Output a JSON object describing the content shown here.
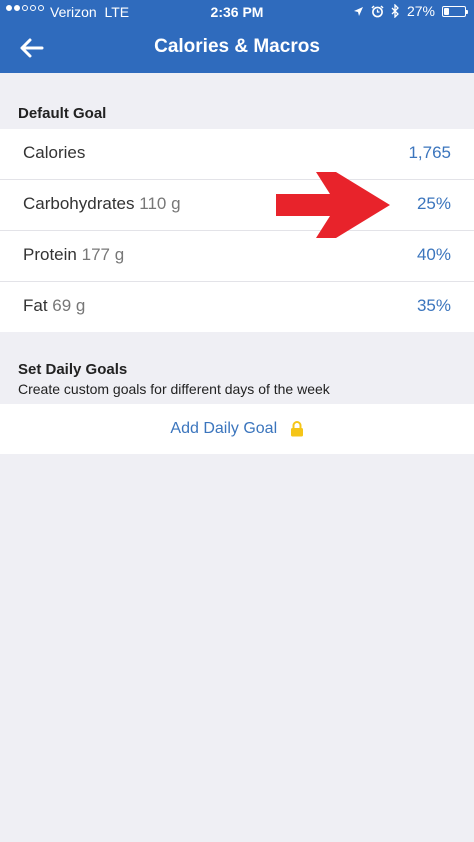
{
  "status_bar": {
    "carrier": "Verizon",
    "network": "LTE",
    "time": "2:36 PM",
    "battery": "27%",
    "battery_level": 0.27,
    "icons": [
      "location-icon",
      "alarm-icon",
      "bluetooth-icon"
    ]
  },
  "nav": {
    "title": "Calories & Macros",
    "back_icon": "back-arrow-icon"
  },
  "default_goal": {
    "header": "Default Goal",
    "rows": [
      {
        "label": "Calories",
        "detail": "",
        "value": "1,765"
      },
      {
        "label": "Carbohydrates",
        "detail": "110 g",
        "value": "25%"
      },
      {
        "label": "Protein",
        "detail": "177 g",
        "value": "40%"
      },
      {
        "label": "Fat",
        "detail": "69 g",
        "value": "35%"
      }
    ]
  },
  "daily_goals": {
    "header": "Set Daily Goals",
    "subtitle": "Create custom goals for different days of the week",
    "add_label": "Add Daily Goal",
    "lock_icon": "lock-icon"
  },
  "colors": {
    "nav_bg": "#2f6bbd",
    "accent": "#3b75bd",
    "annotation_arrow": "#e8232b",
    "lock": "#f5c518"
  }
}
